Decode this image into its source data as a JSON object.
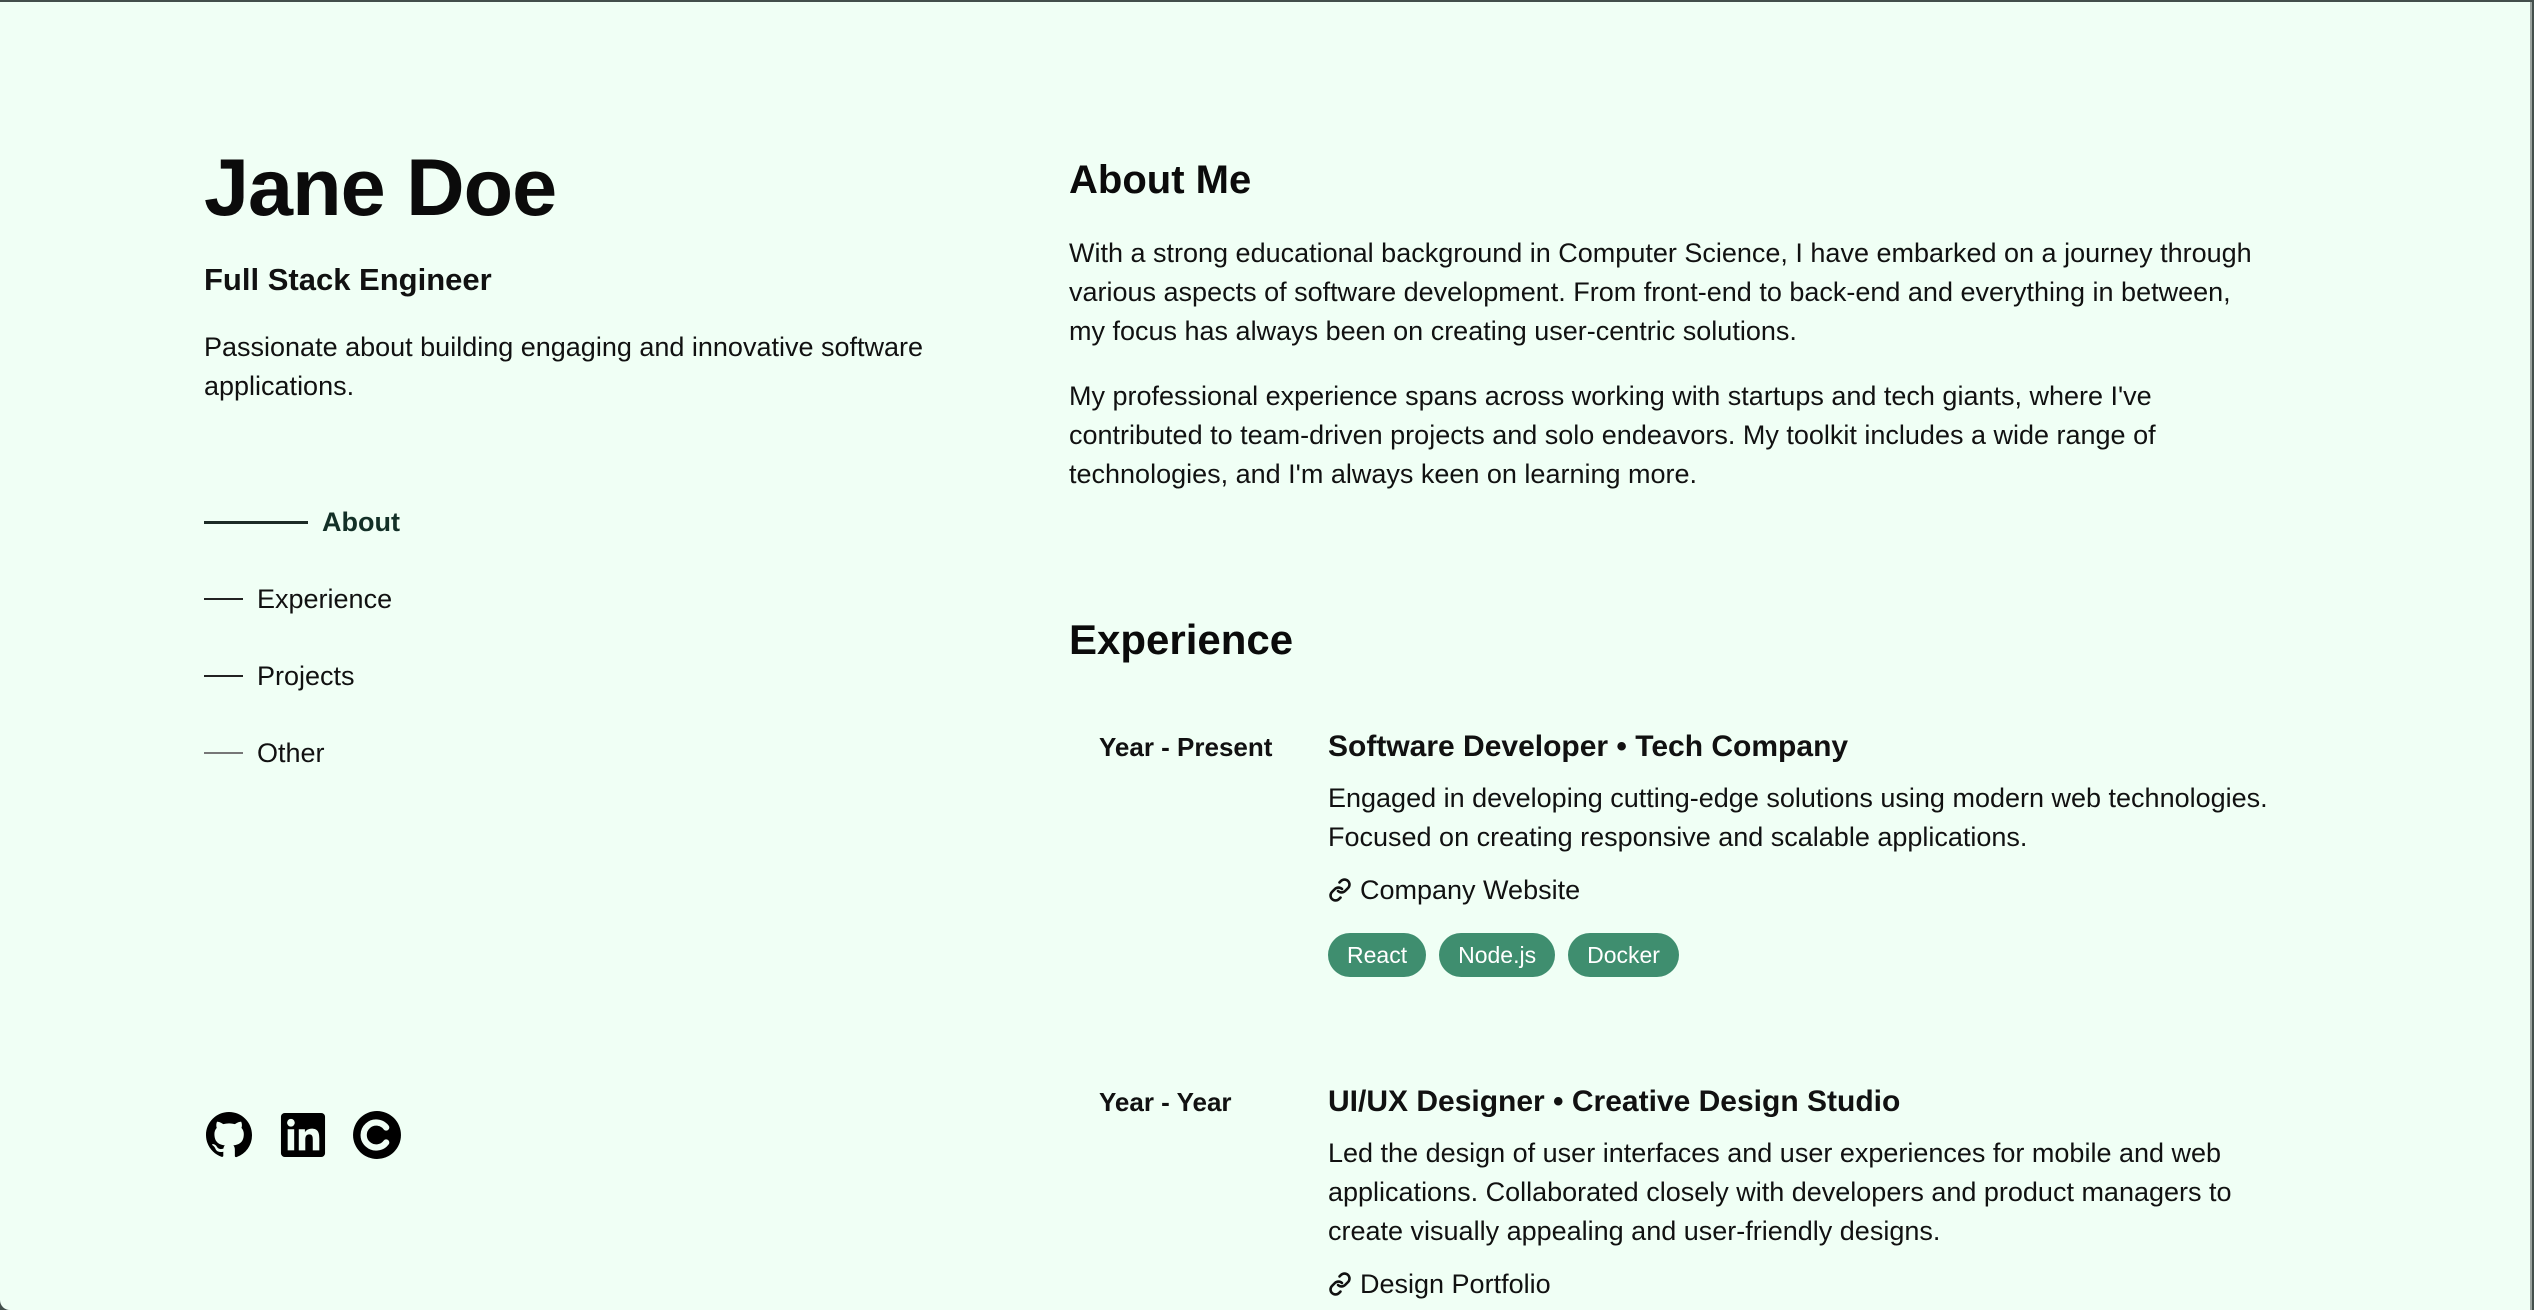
{
  "profile": {
    "name": "Jane Doe",
    "role": "Full Stack Engineer",
    "tagline": "Passionate about building engaging and innovative software applications."
  },
  "nav": {
    "items": [
      {
        "label": "About",
        "active": true
      },
      {
        "label": "Experience",
        "active": false
      },
      {
        "label": "Projects",
        "active": false
      },
      {
        "label": "Other",
        "active": false
      }
    ]
  },
  "socials": [
    {
      "icon": "github-icon"
    },
    {
      "icon": "linkedin-icon"
    },
    {
      "icon": "codepen-icon"
    }
  ],
  "about": {
    "title": "About Me",
    "paragraphs": [
      "With a strong educational background in Computer Science, I have embarked on a journey through various aspects of software development. From front-end to back-end and everything in between, my focus has always been on creating user-centric solutions.",
      "My professional experience spans across working with startups and tech giants, where I've contributed to team-driven projects and solo endeavors. My toolkit includes a wide range of technologies, and I'm always keen on learning more."
    ]
  },
  "experience": {
    "title": "Experience",
    "jobs": [
      {
        "period": "Year - Present",
        "title": "Software Developer • Tech Company",
        "description": "Engaged in developing cutting-edge solutions using modern web technologies. Focused on creating responsive and scalable applications.",
        "link": "Company Website",
        "tags": [
          "React",
          "Node.js",
          "Docker"
        ]
      },
      {
        "period": "Year - Year",
        "title": "UI/UX Designer • Creative Design Studio",
        "description": "Led the design of user interfaces and user experiences for mobile and web applications. Collaborated closely with developers and product managers to create visually appealing and user-friendly designs.",
        "link": "Design Portfolio",
        "tags": []
      }
    ]
  },
  "colors": {
    "background": "#f0fff5",
    "tag": "#3f8e6f",
    "text": "#111111"
  }
}
